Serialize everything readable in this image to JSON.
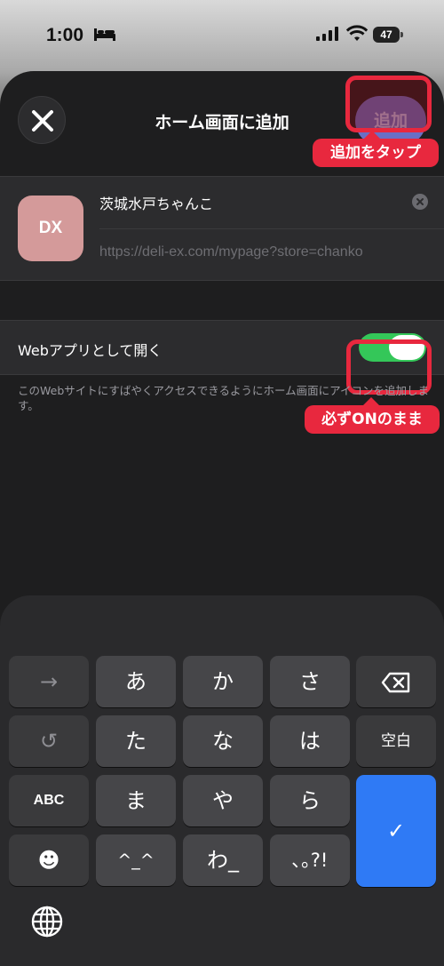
{
  "status_bar": {
    "time": "1:00",
    "battery": "47"
  },
  "sheet": {
    "title": "ホーム画面に追加",
    "add_label": "追加"
  },
  "annotations": {
    "tap_add": "追加をタップ",
    "keep_on": "必ずONのまま"
  },
  "site": {
    "icon_text": "DX",
    "name": "茨城水戸ちゃんこ",
    "url": "https://deli-ex.com/mypage?store=chanko"
  },
  "web_app": {
    "label": "Webアプリとして開く",
    "enabled": true,
    "description": "このWebサイトにすばやくアクセスできるようにホーム画面にアイコンを追加します。"
  },
  "keyboard": {
    "row1": [
      "→",
      "あ",
      "か",
      "さ"
    ],
    "row2": [
      "↺",
      "た",
      "な",
      "は",
      "空白"
    ],
    "row3": [
      "ABC",
      "ま",
      "や",
      "ら"
    ],
    "row4": [
      "☻",
      "^_^",
      "わ_",
      "､｡?!"
    ],
    "confirm": "✓",
    "icons": {
      "delete": "backspace-icon",
      "globe": "globe-icon"
    }
  },
  "colors": {
    "accent": "#2f7af5",
    "toggle_on": "#34c759",
    "annotation": "#e8283e"
  }
}
